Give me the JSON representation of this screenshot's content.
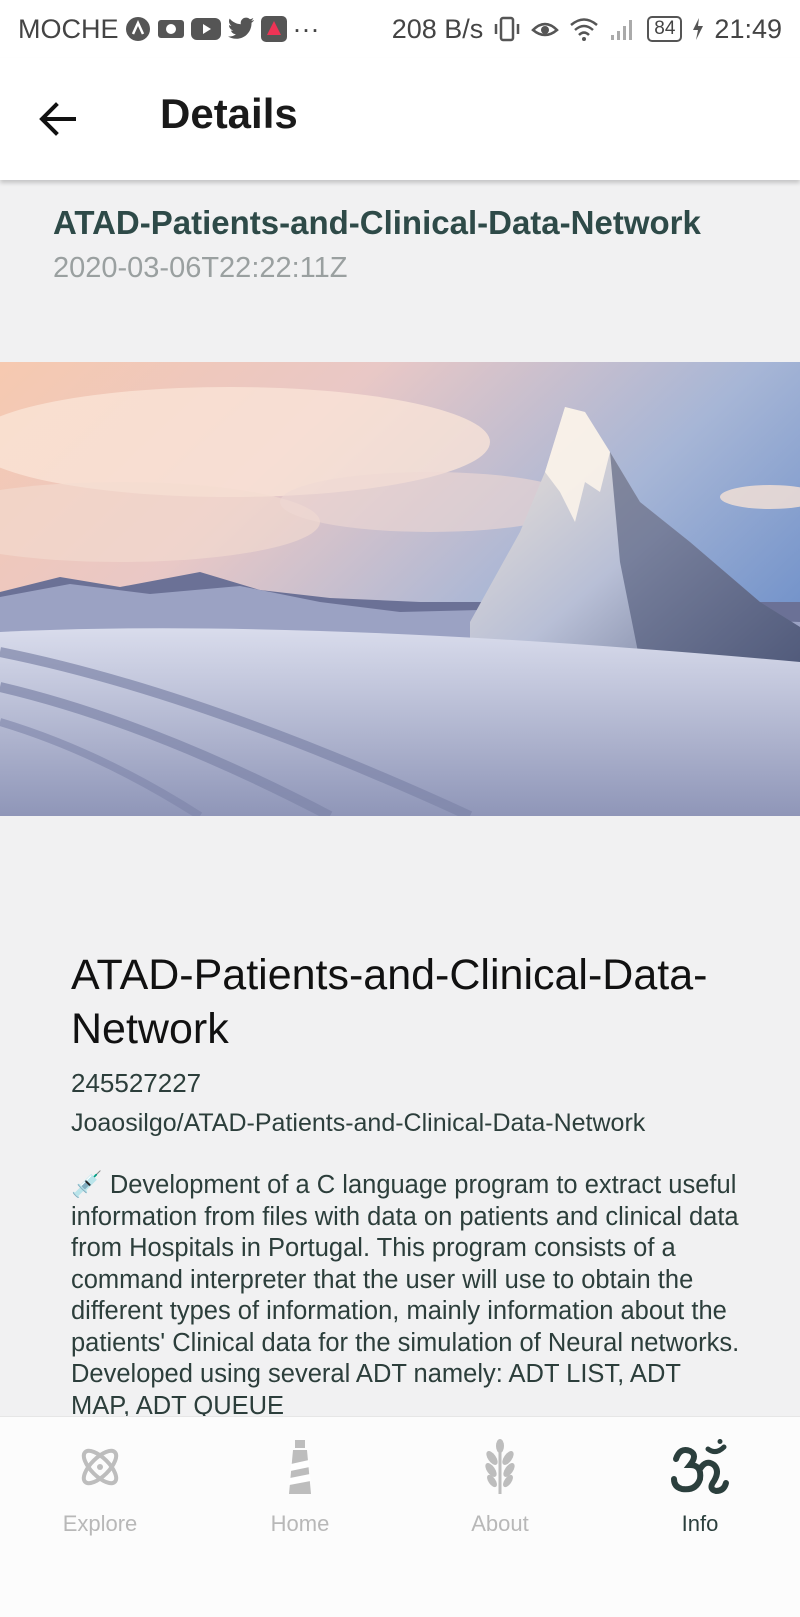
{
  "status_bar": {
    "carrier": "MOCHE",
    "overflow": "···",
    "net_speed": "208 B/s",
    "battery": "84",
    "time": "21:49"
  },
  "app_bar": {
    "title": "Details"
  },
  "repo": {
    "name": "ATAD-Patients-and-Clinical-Data-Network",
    "date": "2020-03-06T22:22:11Z"
  },
  "details": {
    "title": "ATAD-Patients-and-Clinical-Data-Network",
    "id": "245527227",
    "full_name": "Joaosilgo/ATAD-Patients-and-Clinical-Data-Network",
    "description": "💉 Development of a C language program to extract useful information from files with data on patients and clinical data from Hospitals in Portugal. This program consists of a command interpreter that the user will use to obtain the different types of information, mainly information about the patients' Clinical data for the simulation of Neural networks.  Developed using several ADT namely: ADT LIST, ADT MAP, ADT QUEUE"
  },
  "bottom_nav": {
    "items": [
      {
        "label": "Explore",
        "icon": "atom-icon"
      },
      {
        "label": "Home",
        "icon": "lighthouse-icon"
      },
      {
        "label": "About",
        "icon": "wheat-icon"
      },
      {
        "label": "Info",
        "icon": "om-icon"
      }
    ],
    "active_index": 3
  },
  "colors": {
    "accent": "#2e4a48",
    "inactive": "#b8b8b8"
  }
}
